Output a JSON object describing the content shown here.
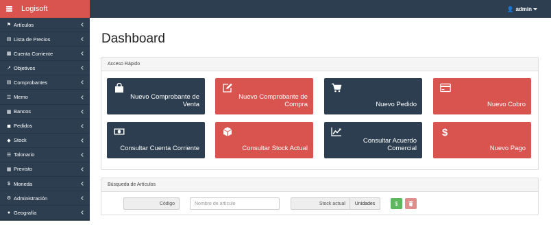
{
  "brand": {
    "name": "Logisoft"
  },
  "topbar": {
    "user": "admin"
  },
  "sidebar": {
    "items": [
      {
        "label": "Artículos",
        "icon": "tag-icon"
      },
      {
        "label": "Lista de Precios",
        "icon": "file-icon"
      },
      {
        "label": "Cuenta Corriente",
        "icon": "id-card-icon"
      },
      {
        "label": "Objetivos",
        "icon": "line-chart-icon"
      },
      {
        "label": "Comprobantes",
        "icon": "document-icon"
      },
      {
        "label": "Memo",
        "icon": "list-icon"
      },
      {
        "label": "Bancos",
        "icon": "bank-icon"
      },
      {
        "label": "Pedidos",
        "icon": "cart-icon"
      },
      {
        "label": "Stock",
        "icon": "cube-icon"
      },
      {
        "label": "Talonario",
        "icon": "list-icon"
      },
      {
        "label": "Previsto",
        "icon": "calendar-icon"
      },
      {
        "label": "Moneda",
        "icon": "dollar-icon"
      },
      {
        "label": "Administración",
        "icon": "cogs-icon"
      },
      {
        "label": "Geografía",
        "icon": "globe-icon"
      }
    ]
  },
  "main": {
    "title": "Dashboard",
    "quick_access": {
      "heading": "Acceso Rápido",
      "tiles": [
        {
          "label": "Nuevo Comprobante de Venta",
          "icon": "shopping-bag-icon",
          "color": "#2c3e50"
        },
        {
          "label": "Nuevo Comprobante de Compra",
          "icon": "edit-icon",
          "color": "#d9534f"
        },
        {
          "label": "Nuevo Pedido",
          "icon": "cart-icon",
          "color": "#2c3e50"
        },
        {
          "label": "Nuevo Cobro",
          "icon": "credit-card-icon",
          "color": "#d9534f"
        },
        {
          "label": "Consultar Cuenta Corriente",
          "icon": "money-icon",
          "color": "#2c3e50"
        },
        {
          "label": "Consultar Stock Actual",
          "icon": "cube-icon",
          "color": "#d9534f"
        },
        {
          "label": "Consultar Acuerdo Comercial",
          "icon": "line-chart-icon",
          "color": "#2c3e50"
        },
        {
          "label": "Nuevo Pago",
          "icon": "dollar-icon",
          "color": "#d9534f"
        }
      ]
    },
    "article_search": {
      "heading": "Búsqueda de Artículos",
      "code_label": "Código",
      "name_placeholder": "Nombre de artículo",
      "stock_label": "Stock actual",
      "units_label": "Unidades",
      "price_button": "$",
      "delete_button": "trash-icon"
    }
  }
}
